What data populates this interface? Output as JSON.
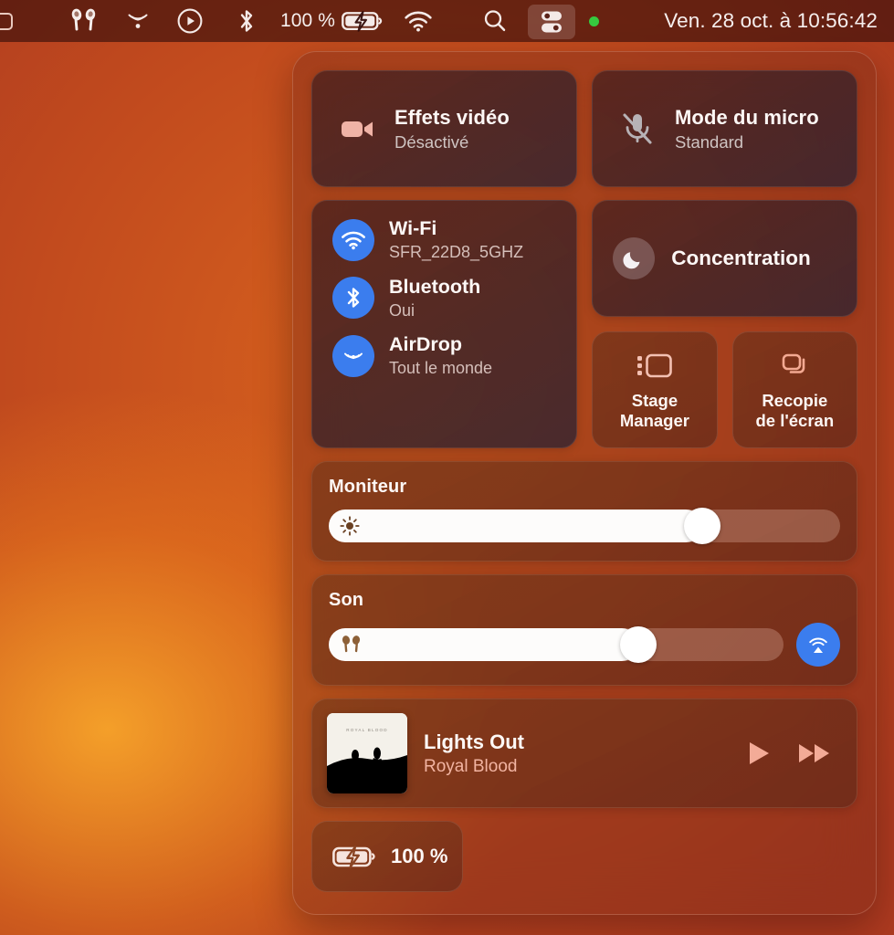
{
  "menubar": {
    "items": [
      {
        "name": "partial-icon",
        "icon": "rounded-square-partial",
        "label": ""
      },
      {
        "name": "airpods-icon",
        "icon": "airpods",
        "label": ""
      },
      {
        "name": "airdrop-icon",
        "icon": "airdrop-waves",
        "label": ""
      },
      {
        "name": "now-playing-icon",
        "icon": "play-circle",
        "label": ""
      },
      {
        "name": "bluetooth-icon",
        "icon": "bluetooth",
        "label": ""
      }
    ],
    "battery_percent": "100 %",
    "battery_icon": "battery-charging",
    "wifi_icon": "wifi",
    "search_icon": "search",
    "control_center_icon": "control-center-sliders",
    "status_dot_color": "#36c93f",
    "clock": "Ven. 28 oct. à 10:56:42"
  },
  "control_center": {
    "video_effects": {
      "title": "Effets vidéo",
      "subtitle": "Désactivé",
      "icon": "video-camera-icon"
    },
    "mic_mode": {
      "title": "Mode du micro",
      "subtitle": "Standard",
      "icon": "microphone-slash-icon"
    },
    "connectivity": [
      {
        "title": "Wi-Fi",
        "subtitle": "SFR_22D8_5GHZ",
        "icon": "wifi-icon",
        "state": "on"
      },
      {
        "title": "Bluetooth",
        "subtitle": "Oui",
        "icon": "bluetooth-icon",
        "state": "on"
      },
      {
        "title": "AirDrop",
        "subtitle": "Tout le monde",
        "icon": "airdrop-icon",
        "state": "on"
      }
    ],
    "focus": {
      "title": "Concentration",
      "icon": "moon-icon"
    },
    "stage_manager": {
      "label_line1": "Stage",
      "label_line2": "Manager",
      "icon": "stage-manager-icon"
    },
    "screen_mirroring": {
      "label_line1": "Recopie",
      "label_line2": "de l'écran",
      "icon": "screen-mirroring-icon"
    },
    "display_slider": {
      "label": "Moniteur",
      "value": 73,
      "icon": "brightness-sun-icon"
    },
    "sound_slider": {
      "label": "Son",
      "value": 68,
      "icon": "airpods-icon",
      "airplay_icon": "airplay-audio-icon"
    },
    "now_playing": {
      "track": "Lights Out",
      "artist": "Royal Blood",
      "album_art_text": "ROYAL BLOOD",
      "play_icon": "play-icon",
      "next_icon": "fast-forward-icon"
    },
    "battery": {
      "label": "100 %",
      "icon": "battery-charging-icon"
    }
  },
  "colors": {
    "accent_blue": "#3b7dee",
    "salmon": "#f2b4a2",
    "status_green": "#36c93f",
    "panel_tint": "#782a18"
  }
}
